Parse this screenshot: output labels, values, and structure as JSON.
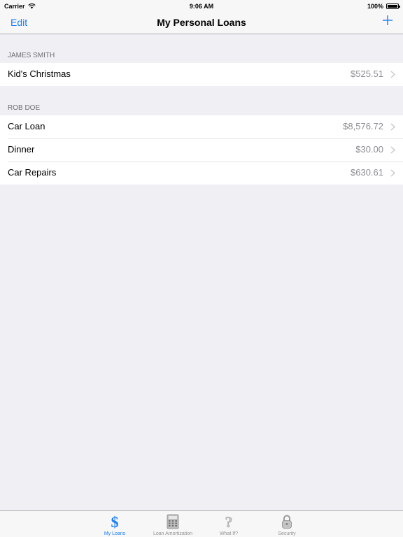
{
  "status_bar": {
    "carrier": "Carrier",
    "time": "9:06 AM",
    "battery": "100%",
    "battery_level": 1.0
  },
  "nav": {
    "edit_label": "Edit",
    "title": "My Personal Loans",
    "add_icon": "plus-icon"
  },
  "sections": [
    {
      "header": "JAMES SMITH",
      "rows": [
        {
          "label": "Kid's Christmas",
          "amount": "$525.51"
        }
      ]
    },
    {
      "header": "ROB DOE",
      "rows": [
        {
          "label": "Car Loan",
          "amount": "$8,576.72"
        },
        {
          "label": "Dinner",
          "amount": "$30.00"
        },
        {
          "label": "Car Repairs",
          "amount": "$630.61"
        }
      ]
    }
  ],
  "tabs": [
    {
      "label": "My Loans",
      "icon": "dollar-icon",
      "active": true
    },
    {
      "label": "Loan Amortization",
      "icon": "calculator-icon",
      "active": false
    },
    {
      "label": "What If?",
      "icon": "question-mark-icon",
      "active": false
    },
    {
      "label": "Security",
      "icon": "padlock-icon",
      "active": false
    }
  ],
  "colors": {
    "accent": "#1a7efb",
    "background": "#efeff4",
    "secondary_text": "#8e8e93",
    "inactive_tab": "#929292"
  }
}
